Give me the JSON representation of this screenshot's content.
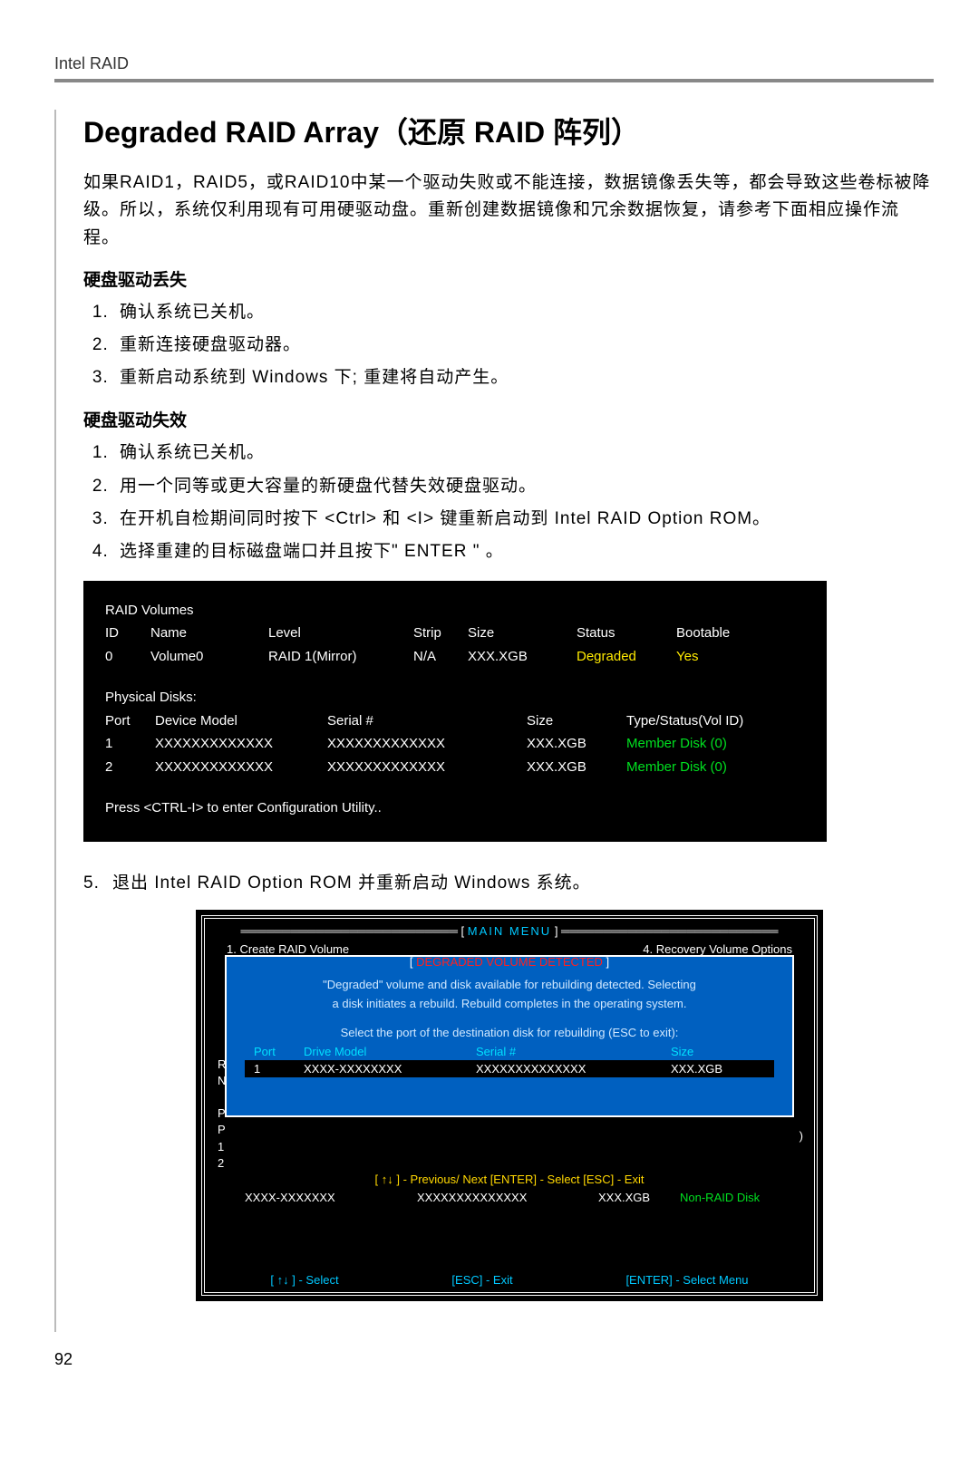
{
  "header": "Intel RAID",
  "title": "Degraded RAID Array（还原 RAID 阵列）",
  "intro": "如果RAID1，RAID5，或RAID10中某一个驱动失败或不能连接，数据镜像丢失等，都会导致这些卷标被降级。所以，系统仅利用现有可用硬驱动盘。重新创建数据镜像和冗余数据恢复，请参考下面相应操作流程。",
  "sub1": "硬盘驱动丢失",
  "s1_1": "确认系统已关机。",
  "s1_2": "重新连接硬盘驱动器。",
  "s1_3": "重新启动系统到 Windows 下; 重建将自动产生。",
  "sub2": "硬盘驱动失效",
  "s2_1": "确认系统已关机。",
  "s2_2": "用一个同等或更大容量的新硬盘代替失效硬盘驱动。",
  "s2_3": "在开机自检期间同时按下 <Ctrl> 和 <I> 键重新启动到 Intel RAID Option ROM。",
  "s2_4": "选择重建的目标磁盘端口并且按下\" ENTER \" 。",
  "console1": {
    "rv": "RAID Volumes",
    "h": {
      "id": "ID",
      "name": "Name",
      "lvl": "Level",
      "strip": "Strip",
      "size": "Size",
      "stat": "Status",
      "boot": "Bootable"
    },
    "r": {
      "id": "0",
      "name": "Volume0",
      "lvl": "RAID 1(Mirror)",
      "strip": "N/A",
      "size": "XXX.XGB",
      "stat": "Degraded",
      "boot": "Yes"
    },
    "pd": "Physical Disks:",
    "ph": {
      "port": "Port",
      "dm": "Device Model",
      "ser": "Serial #",
      "sz": "Size",
      "type": "Type/Status(Vol ID)"
    },
    "p1": {
      "port": "1",
      "dm": "XXXXXXXXXXXXX",
      "ser": "XXXXXXXXXXXXX",
      "sz": "XXX.XGB",
      "type": "Member  Disk (0)"
    },
    "p2": {
      "port": "2",
      "dm": "XXXXXXXXXXXXX",
      "ser": "XXXXXXXXXXXXX",
      "sz": "XXX.XGB",
      "type": "Member  Disk (0)"
    },
    "press": "Press  <CTRL-I>  to enter Configuration Utility.."
  },
  "step5_num": "5.",
  "step5": "退出 Intel RAID Option ROM 并重新启动 Windows 系统。",
  "console2": {
    "mm_l": "[",
    "mm": "MAIN  MENU",
    "mm_r": "]",
    "menu_l": "1.      Create  RAID  Volume",
    "menu_r": "4.      Recovery Volume  Options",
    "dvd_l": "[",
    "dvd": " DEGRADED VOLUME DETECTED ",
    "dvd_r": "]",
    "txt1": "\"Degraded\" volume and disk available for rebuilding detected. Selecting",
    "txt2": "a disk initiates a rebuild. Rebuild completes in the  operating system.",
    "sel": "Select the port of the destination disk for rebuilding (ESC to exit):",
    "dh": {
      "port": "Port",
      "drv": "Drive  Model",
      "ser": "Serial  #",
      "sz": "Size"
    },
    "dr": {
      "port": "1",
      "drv": "XXXX-XXXXXXXX",
      "ser": "XXXXXXXXXXXXXX",
      "sz": "XXX.XGB"
    },
    "left_r": "R",
    "left_n": "N",
    "left_p1": "P",
    "left_p2": "P",
    "left_1": "1",
    "left_2": "2",
    "right_paren": ")",
    "hints": "[ ↑↓ ] - Previous/ Next       [ENTER] - Select       [ESC] - Exit",
    "bd": {
      "a": "",
      "b": "XXXX-XXXXXXX",
      "c": "XXXXXXXXXXXXXX",
      "d": "XXX.XGB",
      "e": "Non-RAID  Disk"
    },
    "f1": "[ ↑↓ ] - Select",
    "f2": "[ESC] - Exit",
    "f3": "[ENTER] - Select Menu"
  },
  "page_num": "92"
}
